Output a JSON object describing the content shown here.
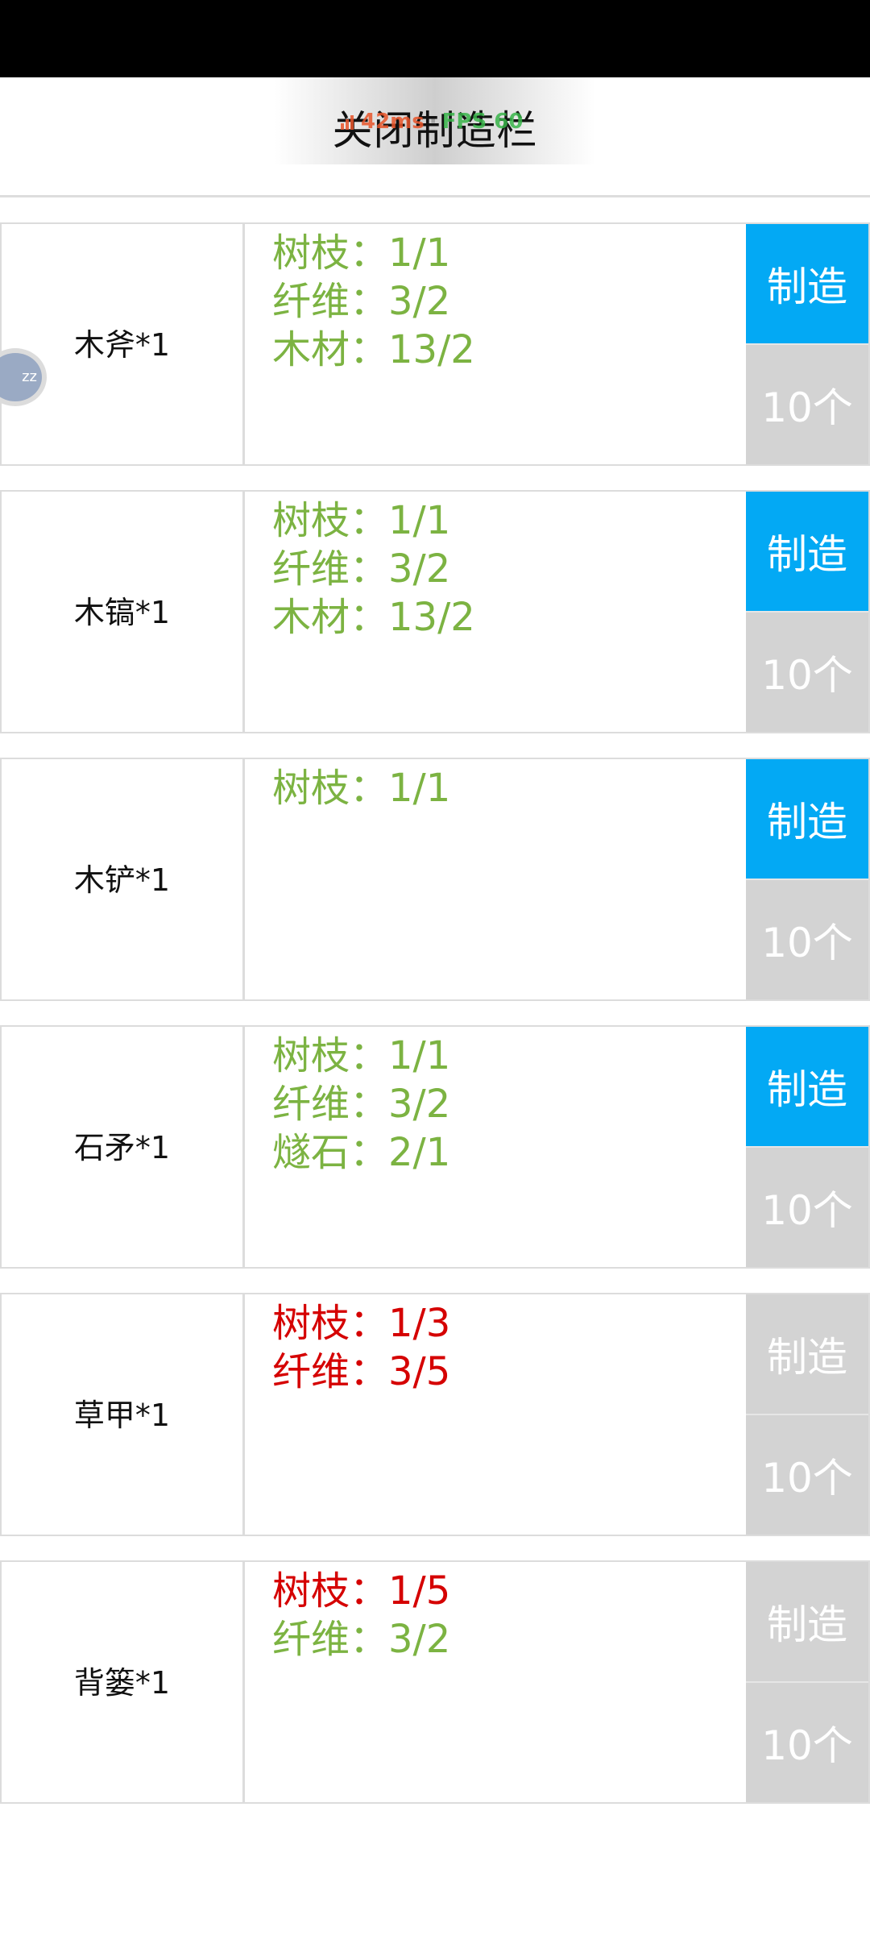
{
  "header": {
    "close_label": "关闭制造栏",
    "ping": "42ms",
    "fps": "FPS 60"
  },
  "float_ball": {
    "label": "zz"
  },
  "recipes": [
    {
      "name": "木斧*1",
      "materials": [
        {
          "text": "树枝：1/1",
          "status": "ok"
        },
        {
          "text": "纤维：3/2",
          "status": "ok"
        },
        {
          "text": "木材：13/2",
          "status": "ok"
        }
      ],
      "craft_label": "制造",
      "craft_enabled": true,
      "ten_label": "10个"
    },
    {
      "name": "木镐*1",
      "materials": [
        {
          "text": "树枝：1/1",
          "status": "ok"
        },
        {
          "text": "纤维：3/2",
          "status": "ok"
        },
        {
          "text": "木材：13/2",
          "status": "ok"
        }
      ],
      "craft_label": "制造",
      "craft_enabled": true,
      "ten_label": "10个"
    },
    {
      "name": "木铲*1",
      "materials": [
        {
          "text": "树枝：1/1",
          "status": "ok"
        }
      ],
      "craft_label": "制造",
      "craft_enabled": true,
      "ten_label": "10个"
    },
    {
      "name": "石矛*1",
      "materials": [
        {
          "text": "树枝：1/1",
          "status": "ok"
        },
        {
          "text": "纤维：3/2",
          "status": "ok"
        },
        {
          "text": "燧石：2/1",
          "status": "ok"
        }
      ],
      "craft_label": "制造",
      "craft_enabled": true,
      "ten_label": "10个"
    },
    {
      "name": "草甲*1",
      "materials": [
        {
          "text": "树枝：1/3",
          "status": "bad"
        },
        {
          "text": "纤维：3/5",
          "status": "bad"
        }
      ],
      "craft_label": "制造",
      "craft_enabled": false,
      "ten_label": "10个"
    },
    {
      "name": "背篓*1",
      "materials": [
        {
          "text": "树枝：1/5",
          "status": "bad"
        },
        {
          "text": "纤维：3/2",
          "status": "ok"
        }
      ],
      "craft_label": "制造",
      "craft_enabled": false,
      "ten_label": "10个"
    }
  ],
  "colors": {
    "craft_enabled": "#03a9f4",
    "button_disabled": "#d3d3d3",
    "material_ok": "#7cb342",
    "material_missing": "#d50000"
  }
}
